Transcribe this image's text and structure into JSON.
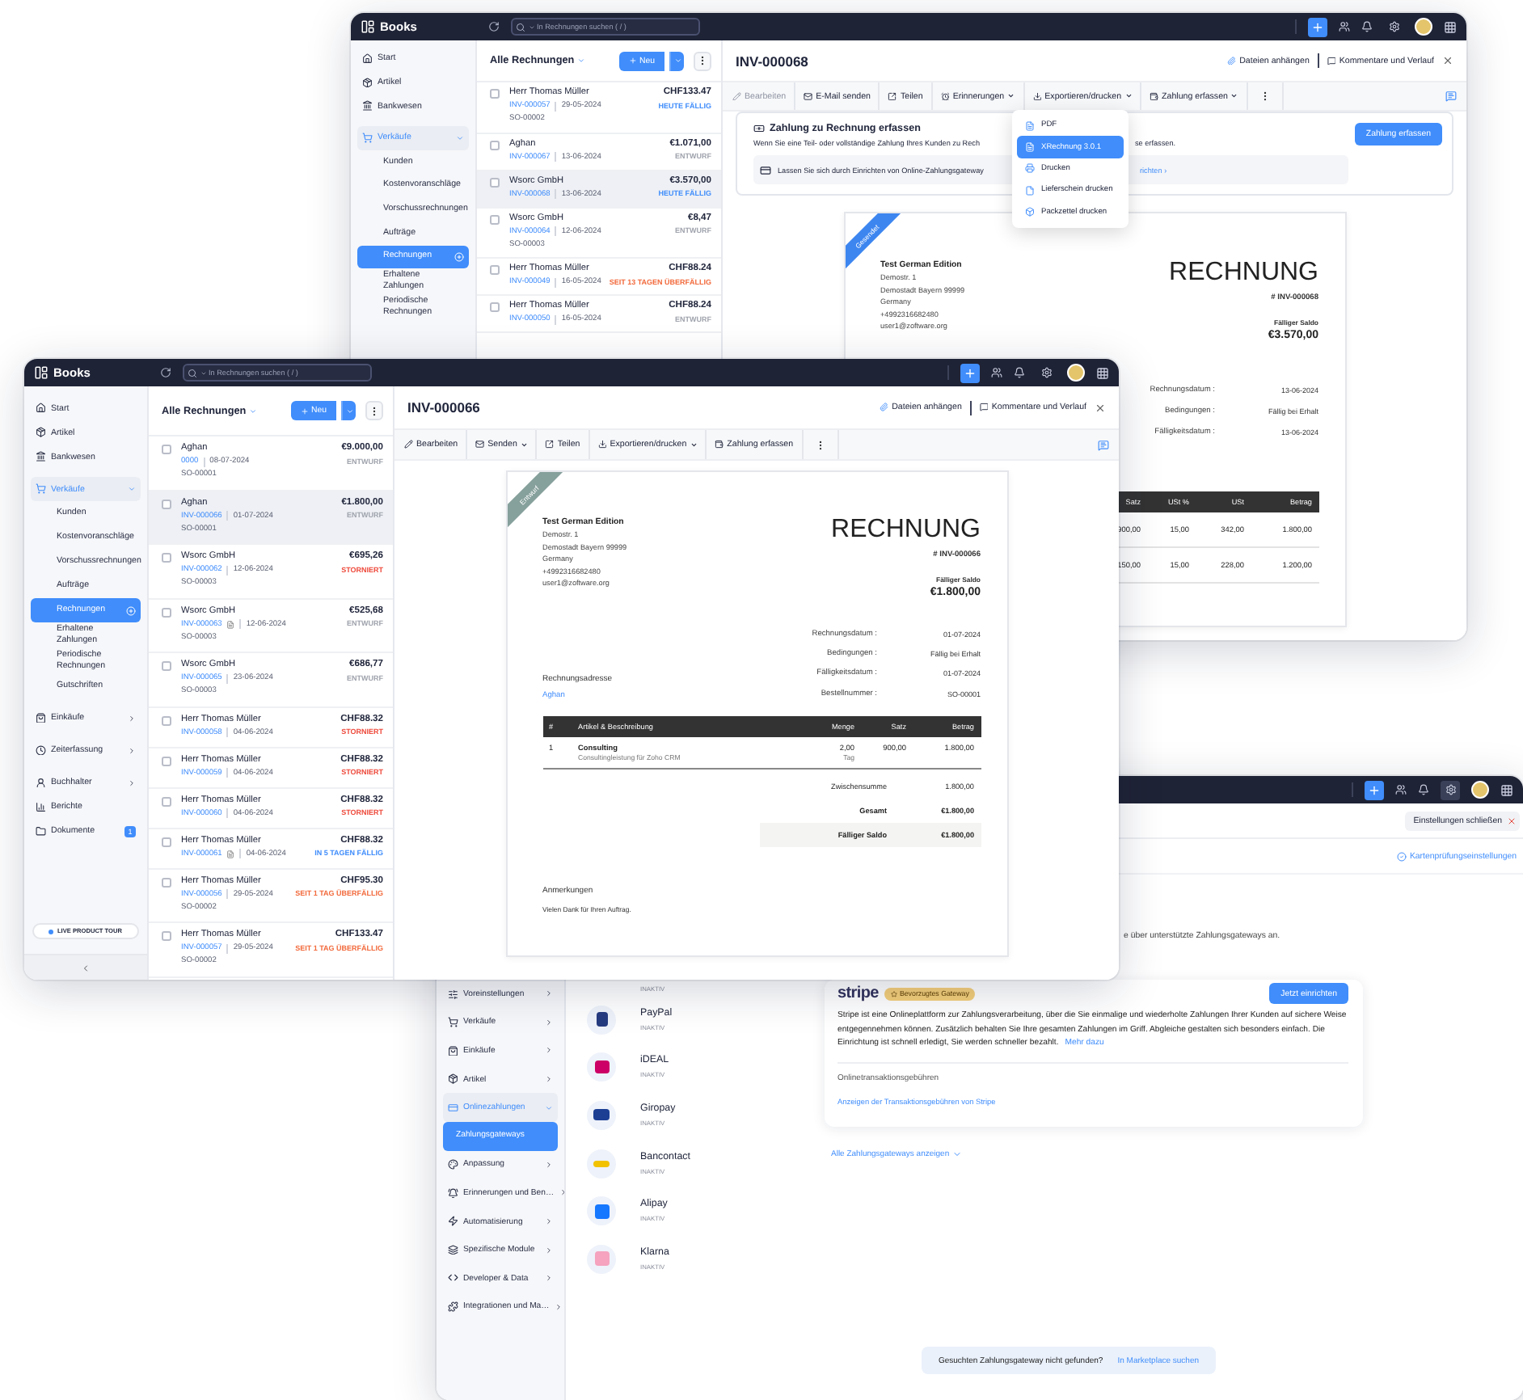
{
  "back_window": {
    "app_name": "Books",
    "search": {
      "placeholder": "In Rechnungen suchen ( / )"
    },
    "sidebar": [
      {
        "label": "Start"
      },
      {
        "label": "Artikel"
      },
      {
        "label": "Bankwesen"
      },
      {
        "label": "Verkäufe",
        "expanded": true,
        "children": [
          {
            "label": "Kunden",
            "selected": false
          },
          {
            "label": "Kostenvoranschläge",
            "selected": false
          },
          {
            "label": "Vorschussrechnungen",
            "selected": false
          },
          {
            "label": "Aufträge",
            "selected": false
          },
          {
            "label": "Rechnungen",
            "selected": true
          },
          {
            "label": "Erhaltene Zahlungen",
            "selected": false
          },
          {
            "label": "Periodische Rechnungen",
            "selected": false
          }
        ]
      }
    ],
    "invoice_list": {
      "title": "Alle Rechnungen",
      "new_button": "Neu",
      "rows": [
        {
          "customer": "Herr Thomas Müller",
          "number": "INV-000057",
          "date": "29-05-2024",
          "order": "SO-00002",
          "amount": "CHF133.47",
          "status": "HEUTE FÄLLIG",
          "color": "#408dfb",
          "attachment": false,
          "checked": false,
          "selected": false
        },
        {
          "customer": "Aghan",
          "number": "INV-000067",
          "date": "13-06-2024",
          "amount": "€1.071,00",
          "status": "ENTWURF",
          "color": "#a0a4ad",
          "attachment": false,
          "checked": false,
          "selected": false
        },
        {
          "customer": "Wsorc GmbH",
          "number": "INV-000068",
          "date": "13-06-2024",
          "amount": "€3.570,00",
          "status": "HEUTE FÄLLIG",
          "color": "#408dfb",
          "attachment": false,
          "checked": false,
          "selected": true
        },
        {
          "customer": "Wsorc GmbH",
          "number": "INV-000064",
          "date": "12-06-2024",
          "order": "SO-00003",
          "amount": "€8,47",
          "status": "ENTWURF",
          "color": "#a0a4ad",
          "attachment": false,
          "checked": false,
          "selected": false
        },
        {
          "customer": "Herr Thomas Müller",
          "number": "INV-000049",
          "date": "16-05-2024",
          "amount": "CHF88.24",
          "status": "SEIT 13 TAGEN ÜBERFÄLLIG",
          "color": "#f26a3c",
          "attachment": false,
          "checked": false,
          "selected": false
        },
        {
          "customer": "Herr Thomas Müller",
          "number": "INV-000050",
          "date": "16-05-2024",
          "amount": "CHF88.24",
          "status": "ENTWURF",
          "color": "#a0a4ad",
          "attachment": false,
          "checked": false,
          "selected": false
        }
      ]
    },
    "detail": {
      "title": "INV-000068",
      "attach": "Dateien anhängen",
      "comments": "Kommentare und Verlauf",
      "toolbar": [
        {
          "label": "Bearbeiten",
          "dropdown": false,
          "disabled": true
        },
        {
          "label": "E-Mail senden",
          "dropdown": false,
          "disabled": false
        },
        {
          "label": "Teilen",
          "dropdown": false,
          "disabled": false
        },
        {
          "label": "Erinnerungen",
          "dropdown": true,
          "disabled": false
        },
        {
          "label": "Exportieren/drucken",
          "dropdown": true,
          "disabled": false
        },
        {
          "label": "Zahlung erfassen",
          "dropdown": true,
          "disabled": false
        }
      ],
      "export_menu": [
        {
          "label": "PDF",
          "selected": false
        },
        {
          "label": "XRechnung 3.0.1",
          "selected": true
        },
        {
          "label": "Drucken",
          "selected": false
        },
        {
          "label": "Lieferschein drucken",
          "selected": false
        },
        {
          "label": "Packzettel drucken",
          "selected": false
        }
      ],
      "banner": {
        "title": "Zahlung zu Rechnung erfassen",
        "text_before": "Wenn Sie eine Teil- oder vollständige Zahlung Ihres Kunden zu Rech",
        "text_after": "se erfassen.",
        "hint_before": "Lassen Sie sich durch Einrichten von Online-Zahlungsgateway",
        "hint_link": "richten ›",
        "button": "Zahlung erfassen"
      },
      "invoice": {
        "ribbon": "Gesendet",
        "company": "Test German Edition",
        "address_lines": [
          "Demostr. 1",
          "Demostadt Bayern 99999",
          "Germany",
          "+4992316682480",
          "user1@zoftware.org"
        ],
        "heading": "RECHNUNG",
        "number": "# INV-000068",
        "balance_label": "Fälliger Saldo",
        "balance": "€3.570,00",
        "meta": [
          {
            "label": "Rechnungsdatum :",
            "value": "13-06-2024"
          },
          {
            "label": "Bedingungen :",
            "value": "Fällig bei Erhalt"
          },
          {
            "label": "Fälligkeitsdatum :",
            "value": "13-06-2024"
          }
        ],
        "table": {
          "kind": "partial",
          "columns": [
            "Satz",
            "USt %",
            "USt",
            "Betrag"
          ],
          "rows": [
            [
              "900,00",
              "15,00",
              "342,00",
              "1.800,00"
            ],
            [
              "150,00",
              "15,00",
              "228,00",
              "1.200,00"
            ]
          ]
        }
      }
    }
  },
  "front_window": {
    "app_name": "Books",
    "search": {
      "placeholder": "In Rechnungen suchen ( / )"
    },
    "sidebar": [
      {
        "label": "Start"
      },
      {
        "label": "Artikel"
      },
      {
        "label": "Bankwesen"
      },
      {
        "label": "Verkäufe",
        "expanded": true,
        "children": [
          {
            "label": "Kunden",
            "selected": false
          },
          {
            "label": "Kostenvoranschläge",
            "selected": false
          },
          {
            "label": "Vorschussrechnungen",
            "selected": false
          },
          {
            "label": "Aufträge",
            "selected": false
          },
          {
            "label": "Rechnungen",
            "selected": true
          },
          {
            "label": "Erhaltene Zahlungen",
            "selected": false
          },
          {
            "label": "Periodische Rechnungen",
            "selected": false
          },
          {
            "label": "Gutschriften",
            "selected": false
          }
        ]
      },
      {
        "label": "Einkäufe",
        "expanded": false
      },
      {
        "label": "Zeiterfassung",
        "expanded": false
      },
      {
        "label": "Buchhalter",
        "expanded": false
      },
      {
        "label": "Berichte"
      },
      {
        "label": "Dokumente",
        "badge": "1"
      }
    ],
    "tour_button": "LIVE PRODUCT TOUR",
    "invoice_list": {
      "title": "Alle Rechnungen",
      "new_button": "Neu",
      "rows": [
        {
          "customer": "Aghan",
          "number": "0000",
          "date": "08-07-2024",
          "order": "SO-00001",
          "amount": "€9.000,00",
          "status": "ENTWURF",
          "color": "#a0a4ad",
          "attachment": false,
          "checked": false,
          "selected": false
        },
        {
          "customer": "Aghan",
          "number": "INV-000066",
          "date": "01-07-2024",
          "order": "SO-00001",
          "amount": "€1.800,00",
          "status": "ENTWURF",
          "color": "#a0a4ad",
          "attachment": false,
          "checked": false,
          "selected": true
        },
        {
          "customer": "Wsorc GmbH",
          "number": "INV-000062",
          "date": "12-06-2024",
          "order": "SO-00003",
          "amount": "€695,26",
          "status": "STORNIERT",
          "color": "#ee4b3d",
          "attachment": false,
          "checked": false,
          "selected": false
        },
        {
          "customer": "Wsorc GmbH",
          "number": "INV-000063",
          "date": "12-06-2024",
          "order": "SO-00003",
          "amount": "€525,68",
          "status": "ENTWURF",
          "color": "#a0a4ad",
          "attachment": true,
          "checked": false,
          "selected": false
        },
        {
          "customer": "Wsorc GmbH",
          "number": "INV-000065",
          "date": "23-06-2024",
          "order": "SO-00003",
          "amount": "€686,77",
          "status": "ENTWURF",
          "color": "#a0a4ad",
          "attachment": false,
          "checked": false,
          "selected": false
        },
        {
          "customer": "Herr Thomas Müller",
          "number": "INV-000058",
          "date": "04-06-2024",
          "amount": "CHF88.32",
          "status": "STORNIERT",
          "color": "#ee4b3d",
          "attachment": false,
          "checked": false,
          "selected": false
        },
        {
          "customer": "Herr Thomas Müller",
          "number": "INV-000059",
          "date": "04-06-2024",
          "amount": "CHF88.32",
          "status": "STORNIERT",
          "color": "#ee4b3d",
          "attachment": false,
          "checked": false,
          "selected": false
        },
        {
          "customer": "Herr Thomas Müller",
          "number": "INV-000060",
          "date": "04-06-2024",
          "amount": "CHF88.32",
          "status": "STORNIERT",
          "color": "#ee4b3d",
          "attachment": false,
          "checked": false,
          "selected": false
        },
        {
          "customer": "Herr Thomas Müller",
          "number": "INV-000061",
          "date": "04-06-2024",
          "amount": "CHF88.32",
          "status": "IN 5 TAGEN FÄLLIG",
          "color": "#408dfb",
          "attachment": true,
          "checked": false,
          "selected": false
        },
        {
          "customer": "Herr Thomas Müller",
          "number": "INV-000056",
          "date": "29-05-2024",
          "order": "SO-00002",
          "amount": "CHF95.30",
          "status": "SEIT 1 TAG ÜBERFÄLLIG",
          "color": "#f26a3c",
          "attachment": false,
          "checked": false,
          "selected": false
        },
        {
          "customer": "Herr Thomas Müller",
          "number": "INV-000057",
          "date": "29-05-2024",
          "order": "SO-00002",
          "amount": "CHF133.47",
          "status": "SEIT 1 TAG ÜBERFÄLLIG",
          "color": "#f26a3c",
          "attachment": false,
          "checked": false,
          "selected": false
        }
      ]
    },
    "detail": {
      "title": "INV-000066",
      "attach": "Dateien anhängen",
      "comments": "Kommentare und Verlauf",
      "toolbar": [
        {
          "label": "Bearbeiten",
          "dropdown": false,
          "disabled": false
        },
        {
          "label": "Senden",
          "dropdown": true,
          "disabled": false
        },
        {
          "label": "Teilen",
          "dropdown": false,
          "disabled": false
        },
        {
          "label": "Exportieren/drucken",
          "dropdown": true,
          "disabled": false
        },
        {
          "label": "Zahlung erfassen",
          "dropdown": false,
          "disabled": false
        }
      ],
      "invoice": {
        "ribbon": "Entwurf",
        "company": "Test German Edition",
        "address_lines": [
          "Demostr. 1",
          "Demostadt Bayern 99999",
          "Germany",
          "+4992316682480",
          "user1@zoftware.org"
        ],
        "heading": "RECHNUNG",
        "number": "# INV-000066",
        "balance_label": "Fälliger Saldo",
        "balance": "€1.800,00",
        "meta": [
          {
            "label": "Rechnungsdatum :",
            "value": "01-07-2024"
          },
          {
            "label": "Bedingungen :",
            "value": "Fällig bei Erhalt"
          },
          {
            "label": "Fälligkeitsdatum :",
            "value": "01-07-2024"
          },
          {
            "label": "Bestellnummer :",
            "value": "SO-00001"
          }
        ],
        "bill_to_label": "Rechnungsadresse",
        "bill_to": "Aghan",
        "table": {
          "kind": "items",
          "columns": [
            "#",
            "Artikel & Beschreibung",
            "Menge",
            "Satz",
            "Betrag"
          ],
          "items": [
            {
              "index": "1",
              "name": "Consulting",
              "description": "Consultingleistung für Zoho CRM",
              "qty": "2,00",
              "unit": "Tag",
              "rate": "900,00",
              "amount": "1.800,00"
            }
          ]
        },
        "totals": [
          {
            "label": "Zwischensumme",
            "value": "1.800,00",
            "kind": "plain"
          },
          {
            "label": "Gesamt",
            "value": "€1.800,00",
            "kind": "bold"
          },
          {
            "label": "Fälliger Saldo",
            "value": "€1.800,00",
            "kind": "highlight"
          }
        ],
        "notes_label": "Anmerkungen",
        "notes": "Vielen Dank für Ihren Auftrag."
      }
    }
  },
  "settings_window": {
    "close_label": "Einstellungen schließen",
    "card_check_link": "Kartenprüfungseinstellungen",
    "intro": "e über unterstützte Zahlungsgateways an.",
    "sidebar": [
      {
        "label": "Voreinstellungen",
        "expanded": false
      },
      {
        "label": "Verkäufe",
        "expanded": false
      },
      {
        "label": "Einkäufe",
        "expanded": false
      },
      {
        "label": "Artikel",
        "expanded": false
      },
      {
        "label": "Onlinezahlungen",
        "expanded": true,
        "children": [
          {
            "label": "Zahlungsgateways",
            "selected": true
          }
        ]
      },
      {
        "label": "Anpassung",
        "expanded": false
      },
      {
        "label": "Erinnerungen und Ben…",
        "expanded": false
      },
      {
        "label": "Automatisierung",
        "expanded": false
      },
      {
        "label": "Spezifische Module",
        "expanded": false
      },
      {
        "label": "Developer & Data",
        "expanded": false
      },
      {
        "label": "Integrationen und Ma…",
        "expanded": false
      }
    ],
    "gateways": [
      {
        "status": "INAKTIV"
      },
      {
        "name": "PayPal",
        "status": "INAKTIV"
      },
      {
        "name": "iDEAL",
        "status": "INAKTIV"
      },
      {
        "name": "Giropay",
        "status": "INAKTIV"
      },
      {
        "name": "Bancontact",
        "status": "INAKTIV"
      },
      {
        "name": "Alipay",
        "status": "INAKTIV"
      },
      {
        "name": "Klarna",
        "status": "INAKTIV"
      }
    ],
    "stripe": {
      "logo": "stripe",
      "badge": "Bevorzugtes Gateway",
      "button": "Jetzt einrichten",
      "description": "Stripe ist eine Onlineplattform zur Zahlungsverarbeitung, über die Sie einmalige und wiederholte Zahlungen Ihrer Kunden auf sichere Weise entgegennehmen können. Zusätzlich behalten Sie Ihre gesamten Zahlungen im Griff. Abgleiche gestalten sich besonders einfach. Die Einrichtung ist schnell erledigt, Sie werden schneller bezahlt.",
      "more_link": "Mehr dazu",
      "fees_label": "Onlinetransaktionsgebühren",
      "fees_link": "Anzeigen der Transaktionsgebühren von Stripe"
    },
    "show_all": "Alle Zahlungsgateways anzeigen",
    "marketplace": {
      "text": "Gesuchten Zahlungsgateway nicht gefunden?",
      "link": "In Marketplace suchen"
    }
  }
}
